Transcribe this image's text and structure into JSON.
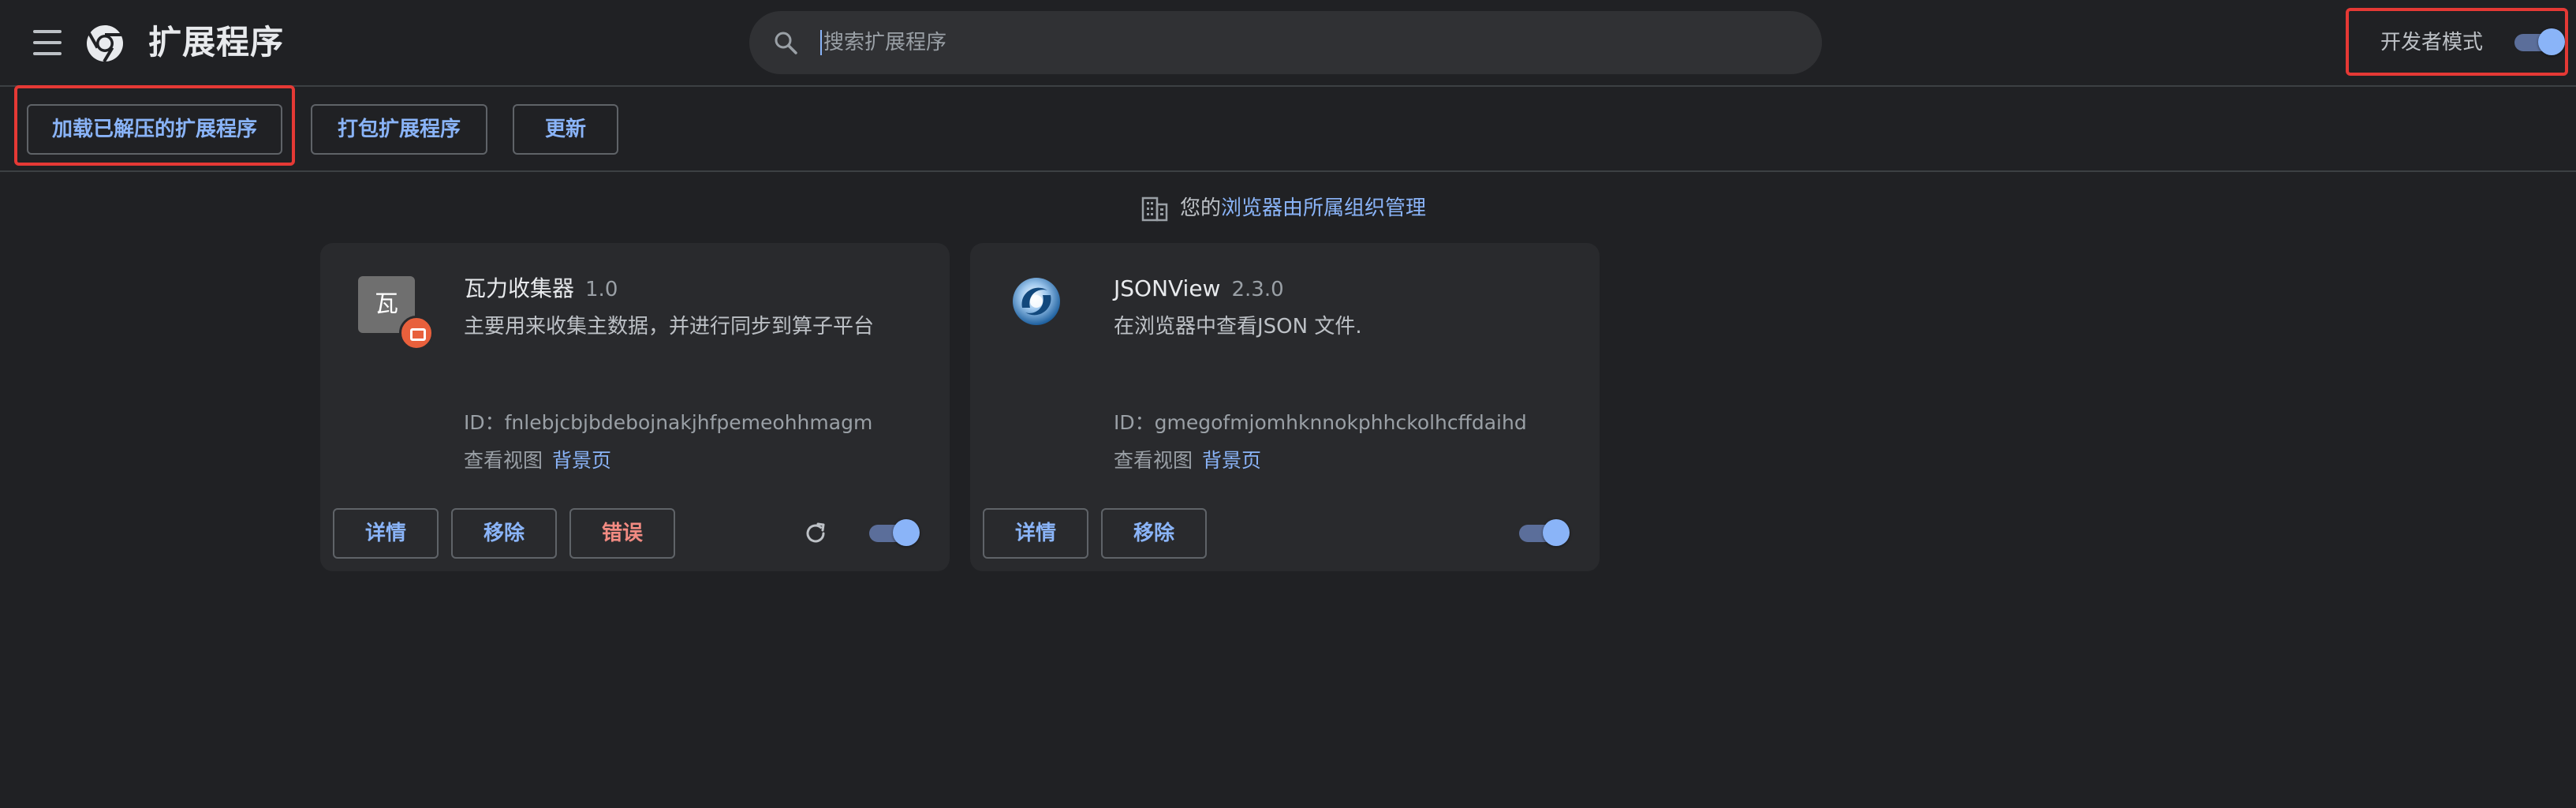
{
  "header": {
    "title": "扩展程序",
    "search_placeholder": "搜索扩展程序",
    "dev_mode_label": "开发者模式",
    "dev_mode_on": true
  },
  "toolbar": {
    "load_unpacked": "加载已解压的扩展程序",
    "pack": "打包扩展程序",
    "update": "更新"
  },
  "managed_notice": {
    "prefix": "您的",
    "link": "浏览器由所属组织管理"
  },
  "extensions": [
    {
      "name": "瓦力收集器",
      "version": "1.0",
      "description": "主要用来收集主数据，并进行同步到算子平台",
      "icon_glyph": "瓦",
      "id_line": "ID：fnlebjcbjbdebojnakjhfpemeohhmagm",
      "views_label": "查看视图",
      "views_link": "背景页",
      "details_label": "详情",
      "remove_label": "移除",
      "errors_label": "错误",
      "enabled": true
    },
    {
      "name": "JSONView",
      "version": "2.3.0",
      "description": "在浏览器中查看JSON 文件.",
      "id_line": "ID：gmegofmjomhknnokphhckolhcffdaihd",
      "views_label": "查看视图",
      "views_link": "背景页",
      "details_label": "详情",
      "remove_label": "移除",
      "enabled": true
    }
  ],
  "colors": {
    "background": "#202124",
    "card": "#292a2d",
    "accent": "#8ab4f8",
    "error": "#f28b82",
    "highlight": "#e53935"
  }
}
